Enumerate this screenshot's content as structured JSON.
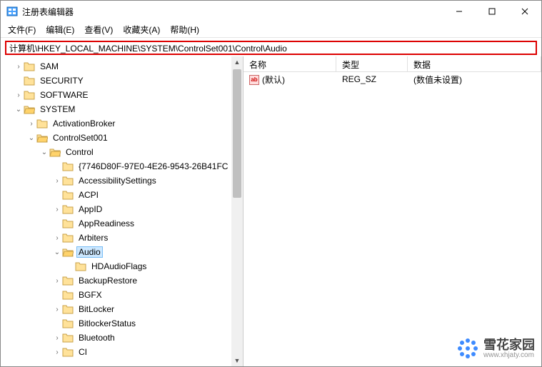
{
  "window": {
    "title": "注册表编辑器"
  },
  "menu": {
    "file": "文件(F)",
    "edit": "编辑(E)",
    "view": "查看(V)",
    "fav": "收藏夹(A)",
    "help": "帮助(H)"
  },
  "address": "计算机\\HKEY_LOCAL_MACHINE\\SYSTEM\\ControlSet001\\Control\\Audio",
  "tree": [
    {
      "indent": 1,
      "expand": "closed",
      "label": "SAM",
      "sel": false
    },
    {
      "indent": 1,
      "expand": "none",
      "label": "SECURITY",
      "sel": false
    },
    {
      "indent": 1,
      "expand": "closed",
      "label": "SOFTWARE",
      "sel": false
    },
    {
      "indent": 1,
      "expand": "open",
      "label": "SYSTEM",
      "sel": false
    },
    {
      "indent": 2,
      "expand": "closed",
      "label": "ActivationBroker",
      "sel": false
    },
    {
      "indent": 2,
      "expand": "open",
      "label": "ControlSet001",
      "sel": false
    },
    {
      "indent": 3,
      "expand": "open",
      "label": "Control",
      "sel": false
    },
    {
      "indent": 4,
      "expand": "none",
      "label": "{7746D80F-97E0-4E26-9543-26B41FC",
      "sel": false
    },
    {
      "indent": 4,
      "expand": "closed",
      "label": "AccessibilitySettings",
      "sel": false
    },
    {
      "indent": 4,
      "expand": "none",
      "label": "ACPI",
      "sel": false
    },
    {
      "indent": 4,
      "expand": "closed",
      "label": "AppID",
      "sel": false
    },
    {
      "indent": 4,
      "expand": "none",
      "label": "AppReadiness",
      "sel": false
    },
    {
      "indent": 4,
      "expand": "closed",
      "label": "Arbiters",
      "sel": false
    },
    {
      "indent": 4,
      "expand": "open",
      "label": "Audio",
      "sel": true
    },
    {
      "indent": 5,
      "expand": "none",
      "label": "HDAudioFlags",
      "sel": false
    },
    {
      "indent": 4,
      "expand": "closed",
      "label": "BackupRestore",
      "sel": false
    },
    {
      "indent": 4,
      "expand": "none",
      "label": "BGFX",
      "sel": false
    },
    {
      "indent": 4,
      "expand": "closed",
      "label": "BitLocker",
      "sel": false
    },
    {
      "indent": 4,
      "expand": "none",
      "label": "BitlockerStatus",
      "sel": false
    },
    {
      "indent": 4,
      "expand": "closed",
      "label": "Bluetooth",
      "sel": false
    },
    {
      "indent": 4,
      "expand": "closed",
      "label": "CI",
      "sel": false
    }
  ],
  "list": {
    "headers": {
      "name": "名称",
      "type": "类型",
      "data": "数据"
    },
    "rows": [
      {
        "name": "(默认)",
        "type": "REG_SZ",
        "data": "(数值未设置)"
      }
    ]
  },
  "watermark": {
    "main": "雪花家园",
    "sub": "www.xhjaty.com"
  }
}
